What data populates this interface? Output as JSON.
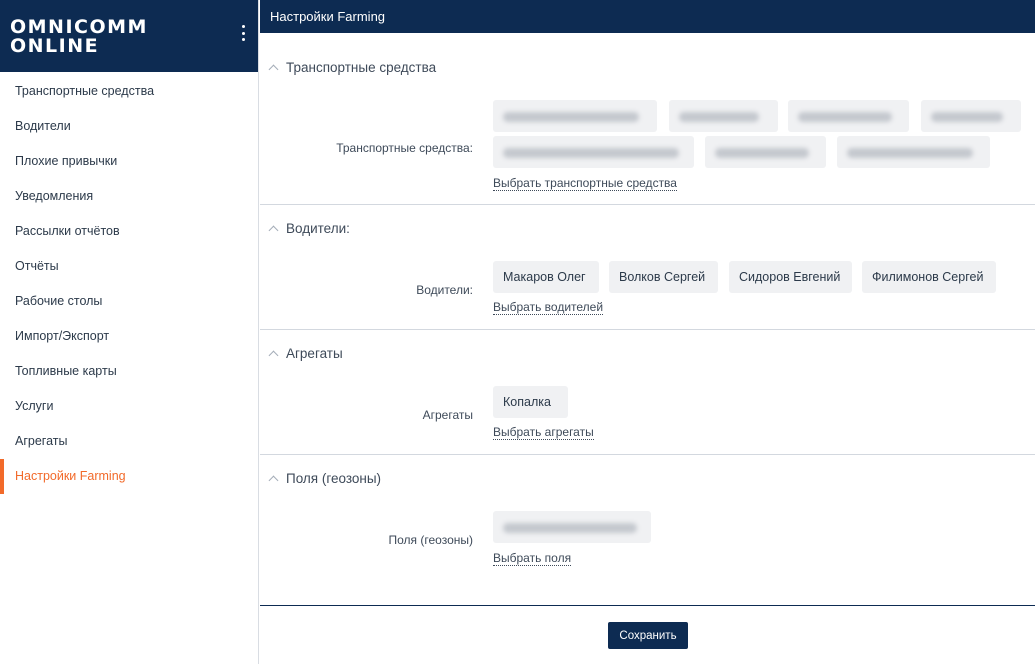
{
  "brand": {
    "line1": "OMNICOMM",
    "line2": "ONLINE"
  },
  "sidebar": {
    "items": [
      {
        "label": "Транспортные средства"
      },
      {
        "label": "Водители"
      },
      {
        "label": "Плохие привычки"
      },
      {
        "label": "Уведомления"
      },
      {
        "label": "Рассылки отчётов"
      },
      {
        "label": "Отчёты"
      },
      {
        "label": "Рабочие столы"
      },
      {
        "label": "Импорт/Экспорт"
      },
      {
        "label": "Топливные карты"
      },
      {
        "label": "Услуги"
      },
      {
        "label": "Агрегаты"
      },
      {
        "label": "Настройки Farming",
        "active": true
      }
    ]
  },
  "header": {
    "title": "Настройки Farming"
  },
  "sections": {
    "vehicles": {
      "title": "Транспортные средства",
      "field_label": "Транспортные средства:",
      "link": "Выбрать транспортные средства"
    },
    "drivers": {
      "title": "Водители:",
      "field_label": "Водители:",
      "chips": [
        "Макаров Олег",
        "Волков Сергей",
        "Сидоров Евгений",
        "Филимонов Сергей"
      ],
      "link": "Выбрать водителей"
    },
    "aggregates": {
      "title": "Агрегаты",
      "field_label": "Агрегаты",
      "chips": [
        "Копалка"
      ],
      "link": "Выбрать агрегаты"
    },
    "fields": {
      "title": "Поля (геозоны)",
      "field_label": "Поля (геозоны)",
      "link": "Выбрать поля"
    }
  },
  "footer": {
    "save_label": "Сохранить"
  },
  "colors": {
    "navy": "#0d2b52",
    "accent": "#f26a2a",
    "chip_bg": "#f0f1f3"
  }
}
